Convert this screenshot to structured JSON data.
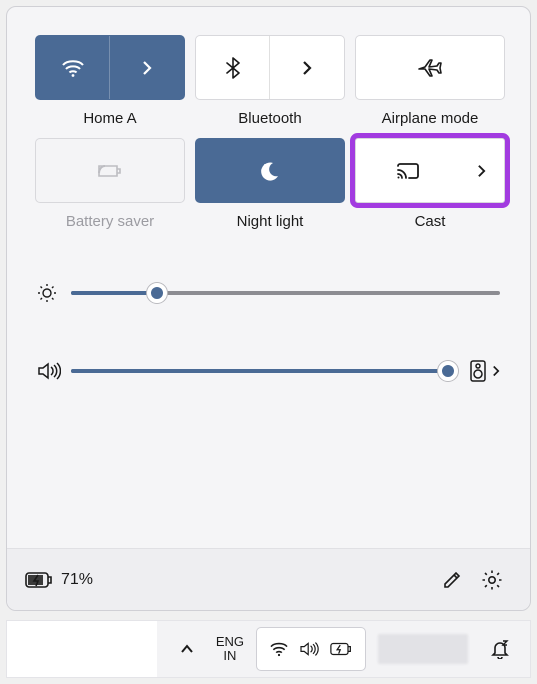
{
  "tiles": {
    "wifi": {
      "label": "Home A"
    },
    "bluetooth": {
      "label": "Bluetooth"
    },
    "airplane": {
      "label": "Airplane mode"
    },
    "battery": {
      "label": "Battery saver"
    },
    "night": {
      "label": "Night light"
    },
    "cast": {
      "label": "Cast"
    }
  },
  "sliders": {
    "brightness_percent": 20,
    "volume_percent": 98
  },
  "footer": {
    "battery_text": "71%"
  },
  "taskbar": {
    "lang_line1": "ENG",
    "lang_line2": "IN"
  }
}
